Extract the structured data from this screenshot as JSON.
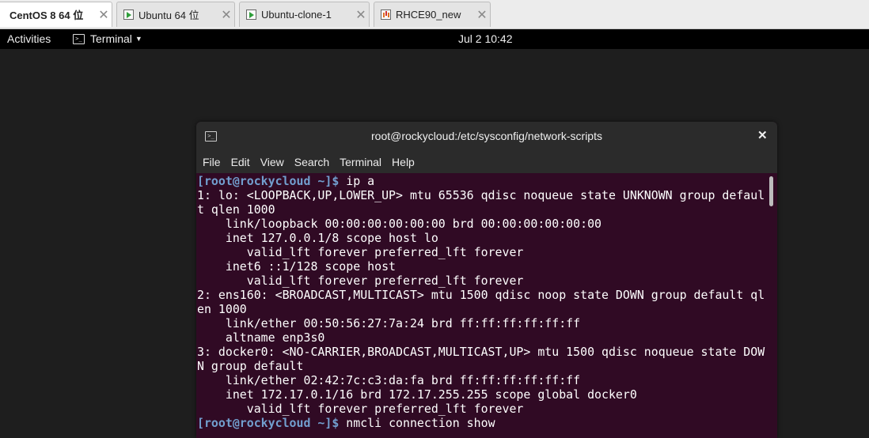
{
  "vm_tabs": [
    {
      "label": "CentOS 8 64 位",
      "active": true
    },
    {
      "label": "Ubuntu 64 位",
      "active": false
    },
    {
      "label": "Ubuntu-clone-1",
      "active": false
    },
    {
      "label": "RHCE90_new",
      "active": false
    }
  ],
  "topbar": {
    "activities": "Activities",
    "app_menu": "Terminal",
    "clock": "Jul 2  10:42"
  },
  "terminal": {
    "title": "root@rockycloud:/etc/sysconfig/network-scripts",
    "menu": [
      "File",
      "Edit",
      "View",
      "Search",
      "Terminal",
      "Help"
    ],
    "lines": [
      {
        "prompt": "[root@rockycloud ~]$",
        "text": " ip a"
      },
      {
        "prompt": "",
        "text": "1: lo: <LOOPBACK,UP,LOWER_UP> mtu 65536 qdisc noqueue state UNKNOWN group defaul"
      },
      {
        "prompt": "",
        "text": "t qlen 1000"
      },
      {
        "prompt": "",
        "text": "    link/loopback 00:00:00:00:00:00 brd 00:00:00:00:00:00"
      },
      {
        "prompt": "",
        "text": "    inet 127.0.0.1/8 scope host lo"
      },
      {
        "prompt": "",
        "text": "       valid_lft forever preferred_lft forever"
      },
      {
        "prompt": "",
        "text": "    inet6 ::1/128 scope host"
      },
      {
        "prompt": "",
        "text": "       valid_lft forever preferred_lft forever"
      },
      {
        "prompt": "",
        "text": "2: ens160: <BROADCAST,MULTICAST> mtu 1500 qdisc noop state DOWN group default ql"
      },
      {
        "prompt": "",
        "text": "en 1000"
      },
      {
        "prompt": "",
        "text": "    link/ether 00:50:56:27:7a:24 brd ff:ff:ff:ff:ff:ff"
      },
      {
        "prompt": "",
        "text": "    altname enp3s0"
      },
      {
        "prompt": "",
        "text": "3: docker0: <NO-CARRIER,BROADCAST,MULTICAST,UP> mtu 1500 qdisc noqueue state DOW"
      },
      {
        "prompt": "",
        "text": "N group default"
      },
      {
        "prompt": "",
        "text": "    link/ether 02:42:7c:c3:da:fa brd ff:ff:ff:ff:ff:ff"
      },
      {
        "prompt": "",
        "text": "    inet 172.17.0.1/16 brd 172.17.255.255 scope global docker0"
      },
      {
        "prompt": "",
        "text": "       valid_lft forever preferred_lft forever"
      },
      {
        "prompt": "[root@rockycloud ~]$",
        "text": " nmcli connection show"
      }
    ]
  },
  "colors": {
    "terminal_bg": "#300a24",
    "prompt": "#729fcf",
    "topbar_bg": "#000000"
  }
}
